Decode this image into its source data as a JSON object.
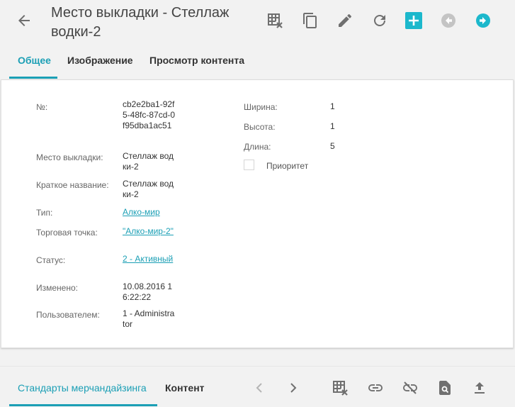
{
  "header": {
    "title": "Место выкладки - Стеллаж водки-2",
    "icons": [
      "arrow-back-icon",
      "table-clear-icon",
      "copy-icon",
      "edit-pencil-icon",
      "refresh-icon",
      "add-icon",
      "prev-record-icon",
      "next-record-icon"
    ]
  },
  "tabs": [
    {
      "label": "Общее",
      "active": true
    },
    {
      "label": "Изображение",
      "active": false
    },
    {
      "label": "Просмотр контента",
      "active": false
    }
  ],
  "fields": {
    "number": {
      "label": "№:",
      "value": "cb2e2ba1-92f5-48fc-87cd-0f95dba1ac51"
    },
    "place": {
      "label": "Место выкладки:",
      "value": "Стеллаж водки-2"
    },
    "short_name": {
      "label": "Краткое название:",
      "value": "Стеллаж водки-2"
    },
    "type": {
      "label": "Тип:",
      "value": "Алко-мир"
    },
    "outlet": {
      "label": "Торговая точка:",
      "value": "\"Алко-мир-2\""
    },
    "status": {
      "label": "Статус:",
      "value": "2 - Активный"
    },
    "modified": {
      "label": "Изменено:",
      "value": "10.08.2016 16:22:22"
    },
    "user": {
      "label": "Пользователем:",
      "value": "1 - Administrator"
    },
    "width": {
      "label": "Ширина:",
      "value": "1"
    },
    "height": {
      "label": "Высота:",
      "value": "1"
    },
    "length": {
      "label": "Длина:",
      "value": "5"
    },
    "priority": {
      "label": "Приоритет",
      "checked": false
    }
  },
  "bottom": {
    "tabs": [
      {
        "label": "Стандарты мерчандайзинга",
        "active": true
      },
      {
        "label": "Контент",
        "active": false
      }
    ],
    "icons": [
      "chevron-left-icon",
      "chevron-right-icon",
      "table-clear-icon",
      "link-icon",
      "unlink-icon",
      "preview-icon",
      "upload-icon"
    ]
  },
  "colors": {
    "accent": "#1b9fb5",
    "icon": "#707070",
    "disabled": "#c4c4c4"
  }
}
